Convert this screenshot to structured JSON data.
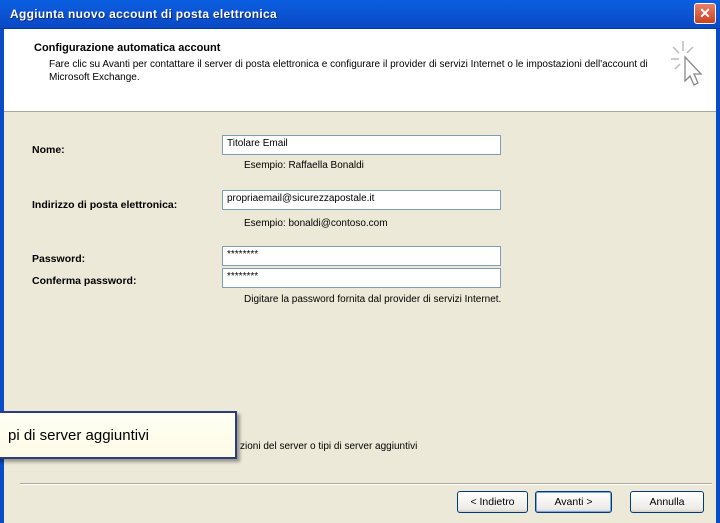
{
  "window": {
    "title": "Aggiunta nuovo account di posta elettronica",
    "close_glyph": "✕"
  },
  "header": {
    "title": "Configurazione automatica account",
    "description": "Fare clic su Avanti per contattare il server di posta elettronica e configurare il provider di servizi Internet o le impostazioni dell'account di Microsoft Exchange."
  },
  "form": {
    "name": {
      "label": "Nome:",
      "value": "Titolare Email",
      "hint": "Esempio: Raffaella Bonaldi"
    },
    "email": {
      "label": "Indirizzo di posta elettronica:",
      "value": "propriaemail@sicurezzapostale.it",
      "hint": "Esempio: bonaldi@contoso.com"
    },
    "password": {
      "label": "Password:",
      "value": "********"
    },
    "confirm": {
      "label": "Conferma password:",
      "value": "********"
    },
    "password_hint": "Digitare la password fornita dal provider di servizi Internet."
  },
  "manual_option": {
    "visible_text": "zioni del server o tipi di server aggiuntivi"
  },
  "tooltip": {
    "text": "pi di server aggiuntivi"
  },
  "buttons": {
    "back": "< Indietro",
    "next": "Avanti >",
    "cancel": "Annulla"
  }
}
